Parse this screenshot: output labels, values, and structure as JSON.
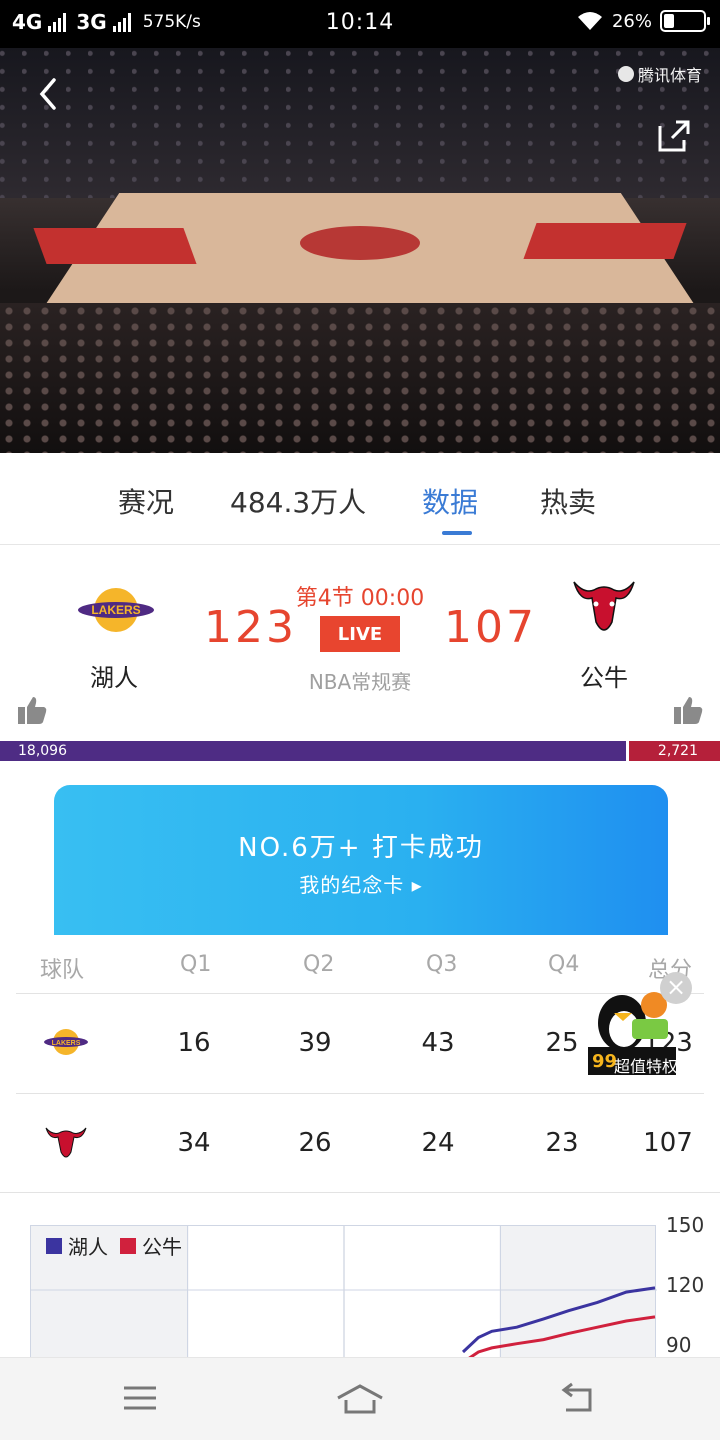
{
  "status_bar": {
    "network1": "4G",
    "network2": "3G",
    "speed": "575K/s",
    "time": "10:14",
    "battery_text": "26%",
    "battery_level": 0.26
  },
  "video": {
    "watermark": "腾讯体育"
  },
  "tabs": [
    {
      "label": "赛况",
      "active": false
    },
    {
      "label": "484.3万人",
      "active": false
    },
    {
      "label": "数据",
      "active": true
    },
    {
      "label": "热卖",
      "active": false
    }
  ],
  "match": {
    "quarter": "第4节  00:00",
    "home": {
      "name": "湖人",
      "score": "123",
      "logo": "lakers-logo"
    },
    "away": {
      "name": "公牛",
      "score": "107",
      "logo": "bulls-logo"
    },
    "live_label": "LIVE",
    "league": "NBA常规赛",
    "support_home": "18,096",
    "support_away": "2,721",
    "support_home_fraction": 0.869
  },
  "card": {
    "title": "NO.6万+ 打卡成功",
    "subtitle": "我的纪念卡"
  },
  "score_table": {
    "headers": [
      "球队",
      "Q1",
      "Q2",
      "Q3",
      "Q4",
      "总分"
    ],
    "rows": [
      {
        "team": "lakers-logo",
        "values": [
          "16",
          "39",
          "43",
          "25",
          "123"
        ]
      },
      {
        "team": "bulls-logo",
        "values": [
          "34",
          "26",
          "24",
          "23",
          "107"
        ]
      }
    ]
  },
  "vip_badge": {
    "text": "99超值特权",
    "number": "99",
    "label": "超值特权"
  },
  "chart": {
    "legend": [
      "湖人",
      "公牛"
    ],
    "y_ticks": [
      "150",
      "120",
      "90"
    ],
    "colors": {
      "home": "#3b34a0",
      "away": "#d0213d"
    }
  },
  "chart_data": {
    "type": "line",
    "title": "",
    "xlabel": "",
    "ylabel": "",
    "ylim": [
      90,
      150
    ],
    "series": [
      {
        "name": "湖人",
        "x": [
          0,
          0.08,
          0.15,
          0.28,
          0.42,
          0.55,
          0.7,
          0.85,
          1.0
        ],
        "values": [
          90,
          97,
          100,
          102,
          106,
          110,
          114,
          119,
          121
        ]
      },
      {
        "name": "公牛",
        "x": [
          0,
          0.08,
          0.15,
          0.28,
          0.42,
          0.55,
          0.7,
          0.85,
          1.0
        ],
        "values": [
          85,
          90,
          92,
          94,
          96,
          99,
          102,
          105,
          107
        ]
      }
    ]
  }
}
